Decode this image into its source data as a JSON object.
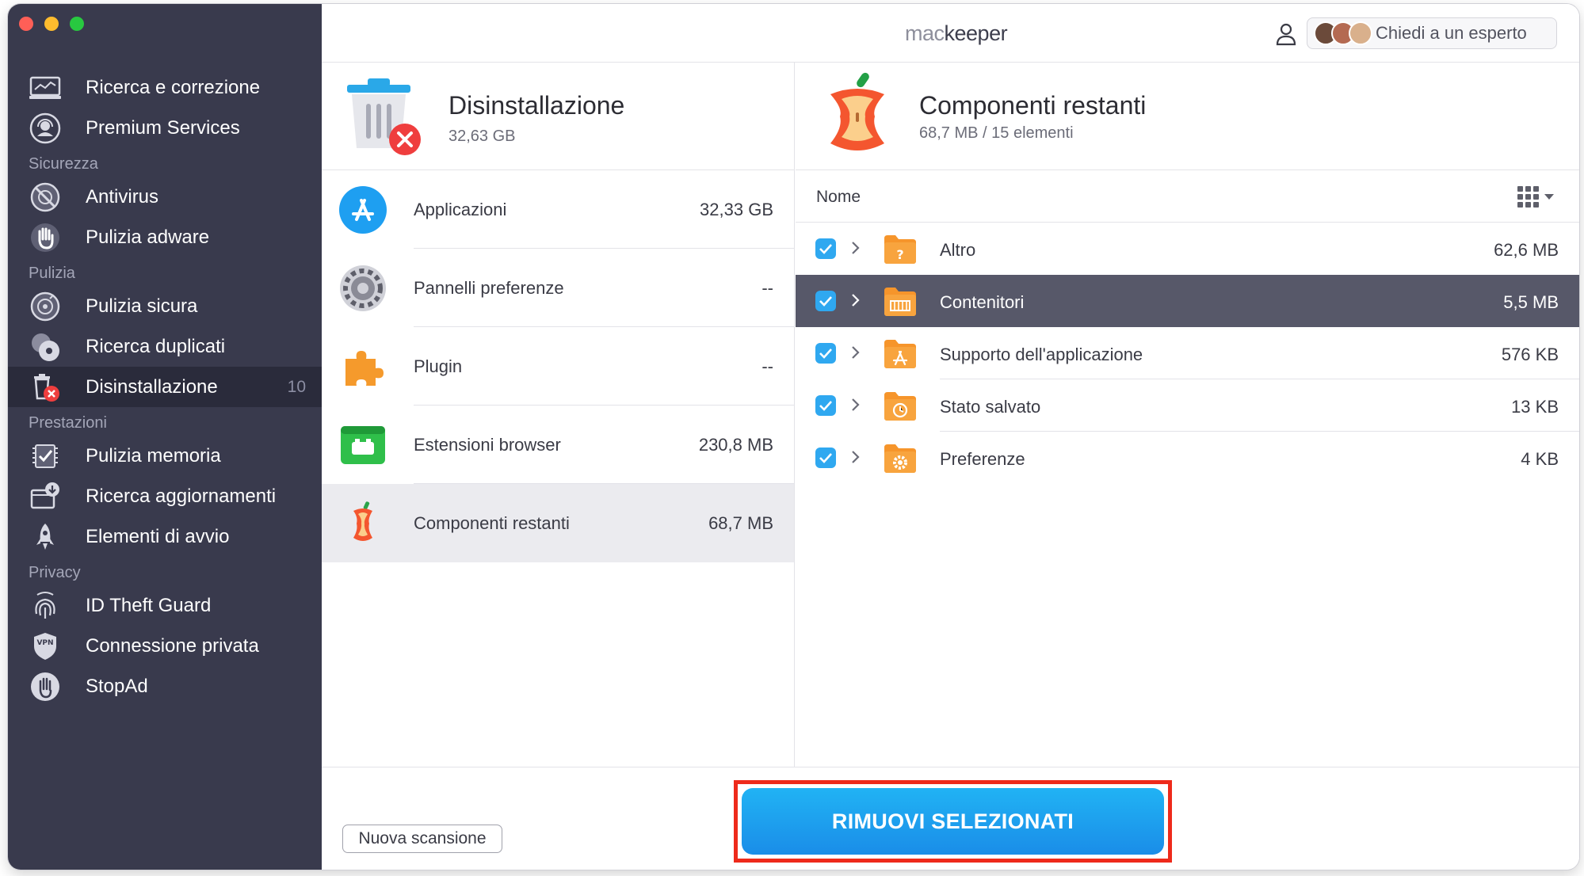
{
  "app": {
    "logo_light": "mac",
    "logo_bold": "keeper"
  },
  "header": {
    "expert_label": "Chiedi a un esperto"
  },
  "sidebar": {
    "items": [
      {
        "label": "Ricerca e correzione",
        "icon": "monitor-scan-icon"
      },
      {
        "label": "Premium Services",
        "icon": "support-agent-icon"
      },
      {
        "section": "Sicurezza"
      },
      {
        "label": "Antivirus",
        "icon": "virus-shield-icon"
      },
      {
        "label": "Pulizia adware",
        "icon": "hand-stop-icon"
      },
      {
        "section": "Pulizia"
      },
      {
        "label": "Pulizia sicura",
        "icon": "disk-clean-icon"
      },
      {
        "label": "Ricerca duplicati",
        "icon": "duplicate-discs-icon"
      },
      {
        "label": "Disinstallazione",
        "icon": "trash-uninstall-icon",
        "badge": "10",
        "active": true
      },
      {
        "section": "Prestazioni"
      },
      {
        "label": "Pulizia memoria",
        "icon": "memory-chip-icon"
      },
      {
        "label": "Ricerca aggiornamenti",
        "icon": "update-download-icon"
      },
      {
        "label": "Elementi di avvio",
        "icon": "rocket-icon"
      },
      {
        "section": "Privacy"
      },
      {
        "label": "ID Theft Guard",
        "icon": "fingerprint-icon"
      },
      {
        "label": "Connessione privata",
        "icon": "vpn-shield-icon"
      },
      {
        "label": "StopAd",
        "icon": "stop-hand-icon"
      }
    ]
  },
  "uninstall": {
    "title": "Disinstallazione",
    "size": "32,63 GB",
    "categories": [
      {
        "label": "Applicazioni",
        "size": "32,33 GB",
        "icon": "app-store-icon"
      },
      {
        "label": "Pannelli preferenze",
        "size": "--",
        "icon": "gear-icon"
      },
      {
        "label": "Plugin",
        "size": "--",
        "icon": "puzzle-icon"
      },
      {
        "label": "Estensioni browser",
        "size": "230,8 MB",
        "icon": "browser-extension-icon"
      },
      {
        "label": "Componenti restanti",
        "size": "68,7 MB",
        "icon": "apple-core-icon",
        "selected": true
      }
    ]
  },
  "leftovers": {
    "title": "Componenti restanti",
    "subtitle": "68,7 MB / 15 elementi",
    "column_name": "Nome",
    "rows": [
      {
        "label": "Altro",
        "size": "62,6 MB",
        "checked": true,
        "icon": "folder-question-icon"
      },
      {
        "label": "Contenitori",
        "size": "5,5 MB",
        "checked": true,
        "icon": "folder-container-icon",
        "selected": true
      },
      {
        "label": "Supporto dell'applicazione",
        "size": "576 KB",
        "checked": true,
        "icon": "folder-app-support-icon"
      },
      {
        "label": "Stato salvato",
        "size": "13 KB",
        "checked": true,
        "icon": "folder-clock-icon"
      },
      {
        "label": "Preferenze",
        "size": "4 KB",
        "checked": true,
        "icon": "folder-gear-icon"
      }
    ]
  },
  "footer": {
    "rescan_label": "Nuova scansione",
    "remove_label": "RIMUOVI SELEZIONATI"
  },
  "colors": {
    "sidebar_bg": "#393a4d",
    "sidebar_active": "#2a2b3b",
    "accent_blue": "#1a9bef",
    "selected_row": "#575869",
    "highlight_red": "#ee2a1b",
    "folder_orange": "#f6952b"
  }
}
